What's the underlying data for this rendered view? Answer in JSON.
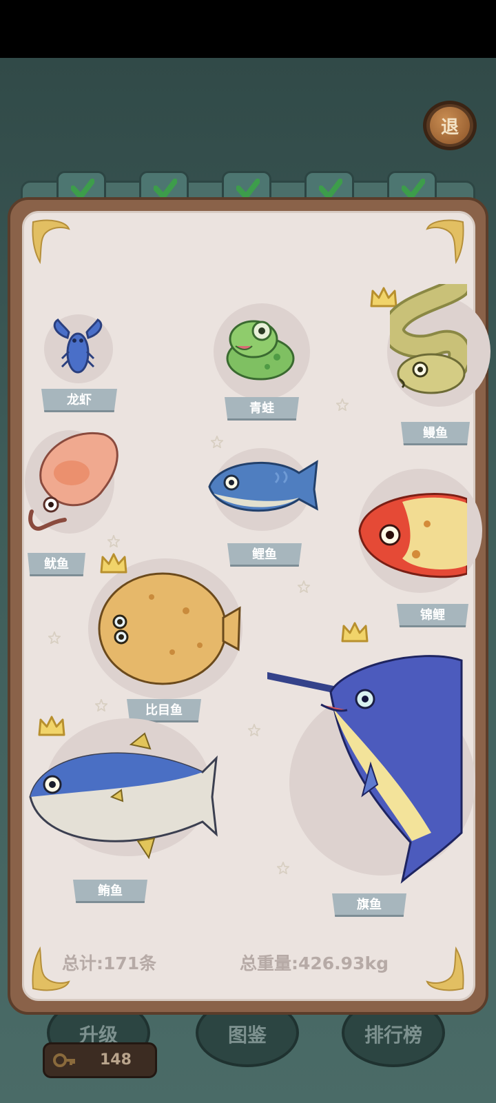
{
  "exit_button": {
    "label": "退"
  },
  "tabs": [
    "tab-1",
    "tab-2",
    "tab-3",
    "tab-4",
    "tab-5"
  ],
  "creatures": {
    "lobster": "龙虾",
    "frog": "青蛙",
    "eel": "鳗鱼",
    "squid": "鱿鱼",
    "carp": "鲤鱼",
    "koi": "锦鲤",
    "flounder": "比目鱼",
    "tuna": "鲔鱼",
    "marlin": "旗鱼"
  },
  "summary": {
    "total_count": "总计:171条",
    "total_weight": "总重量:426.93kg"
  },
  "bottom_buttons": {
    "upgrade": "升级",
    "collection": "图鉴",
    "leaderboard": "排行榜"
  },
  "key_count": "148",
  "colors": {
    "accent_gold": "#e7c24a",
    "label_bg": "#a7b6bd",
    "panel_bg": "#ebe3df",
    "frame": "#8a6249"
  }
}
